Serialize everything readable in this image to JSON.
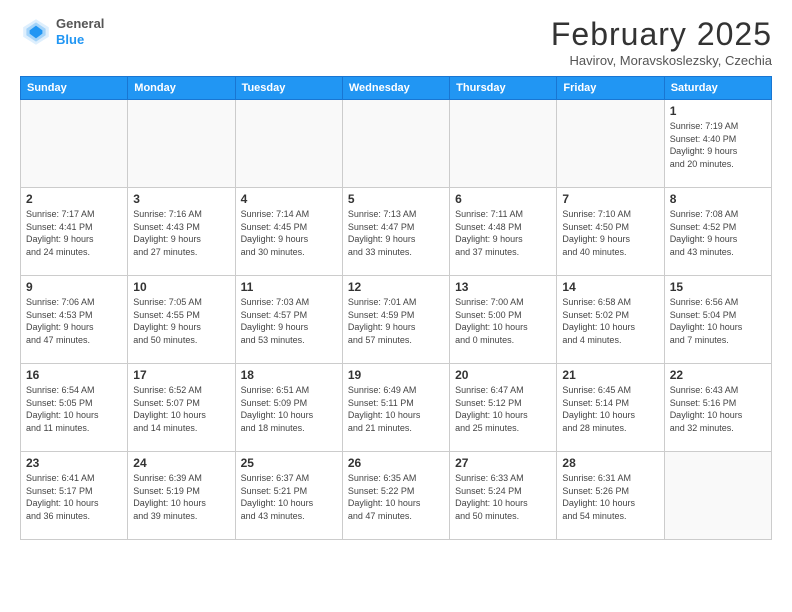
{
  "header": {
    "logo_general": "General",
    "logo_blue": "Blue",
    "month_title": "February 2025",
    "subtitle": "Havirov, Moravskoslezsky, Czechia"
  },
  "weekdays": [
    "Sunday",
    "Monday",
    "Tuesday",
    "Wednesday",
    "Thursday",
    "Friday",
    "Saturday"
  ],
  "weeks": [
    [
      {
        "day": "",
        "info": ""
      },
      {
        "day": "",
        "info": ""
      },
      {
        "day": "",
        "info": ""
      },
      {
        "day": "",
        "info": ""
      },
      {
        "day": "",
        "info": ""
      },
      {
        "day": "",
        "info": ""
      },
      {
        "day": "1",
        "info": "Sunrise: 7:19 AM\nSunset: 4:40 PM\nDaylight: 9 hours\nand 20 minutes."
      }
    ],
    [
      {
        "day": "2",
        "info": "Sunrise: 7:17 AM\nSunset: 4:41 PM\nDaylight: 9 hours\nand 24 minutes."
      },
      {
        "day": "3",
        "info": "Sunrise: 7:16 AM\nSunset: 4:43 PM\nDaylight: 9 hours\nand 27 minutes."
      },
      {
        "day": "4",
        "info": "Sunrise: 7:14 AM\nSunset: 4:45 PM\nDaylight: 9 hours\nand 30 minutes."
      },
      {
        "day": "5",
        "info": "Sunrise: 7:13 AM\nSunset: 4:47 PM\nDaylight: 9 hours\nand 33 minutes."
      },
      {
        "day": "6",
        "info": "Sunrise: 7:11 AM\nSunset: 4:48 PM\nDaylight: 9 hours\nand 37 minutes."
      },
      {
        "day": "7",
        "info": "Sunrise: 7:10 AM\nSunset: 4:50 PM\nDaylight: 9 hours\nand 40 minutes."
      },
      {
        "day": "8",
        "info": "Sunrise: 7:08 AM\nSunset: 4:52 PM\nDaylight: 9 hours\nand 43 minutes."
      }
    ],
    [
      {
        "day": "9",
        "info": "Sunrise: 7:06 AM\nSunset: 4:53 PM\nDaylight: 9 hours\nand 47 minutes."
      },
      {
        "day": "10",
        "info": "Sunrise: 7:05 AM\nSunset: 4:55 PM\nDaylight: 9 hours\nand 50 minutes."
      },
      {
        "day": "11",
        "info": "Sunrise: 7:03 AM\nSunset: 4:57 PM\nDaylight: 9 hours\nand 53 minutes."
      },
      {
        "day": "12",
        "info": "Sunrise: 7:01 AM\nSunset: 4:59 PM\nDaylight: 9 hours\nand 57 minutes."
      },
      {
        "day": "13",
        "info": "Sunrise: 7:00 AM\nSunset: 5:00 PM\nDaylight: 10 hours\nand 0 minutes."
      },
      {
        "day": "14",
        "info": "Sunrise: 6:58 AM\nSunset: 5:02 PM\nDaylight: 10 hours\nand 4 minutes."
      },
      {
        "day": "15",
        "info": "Sunrise: 6:56 AM\nSunset: 5:04 PM\nDaylight: 10 hours\nand 7 minutes."
      }
    ],
    [
      {
        "day": "16",
        "info": "Sunrise: 6:54 AM\nSunset: 5:05 PM\nDaylight: 10 hours\nand 11 minutes."
      },
      {
        "day": "17",
        "info": "Sunrise: 6:52 AM\nSunset: 5:07 PM\nDaylight: 10 hours\nand 14 minutes."
      },
      {
        "day": "18",
        "info": "Sunrise: 6:51 AM\nSunset: 5:09 PM\nDaylight: 10 hours\nand 18 minutes."
      },
      {
        "day": "19",
        "info": "Sunrise: 6:49 AM\nSunset: 5:11 PM\nDaylight: 10 hours\nand 21 minutes."
      },
      {
        "day": "20",
        "info": "Sunrise: 6:47 AM\nSunset: 5:12 PM\nDaylight: 10 hours\nand 25 minutes."
      },
      {
        "day": "21",
        "info": "Sunrise: 6:45 AM\nSunset: 5:14 PM\nDaylight: 10 hours\nand 28 minutes."
      },
      {
        "day": "22",
        "info": "Sunrise: 6:43 AM\nSunset: 5:16 PM\nDaylight: 10 hours\nand 32 minutes."
      }
    ],
    [
      {
        "day": "23",
        "info": "Sunrise: 6:41 AM\nSunset: 5:17 PM\nDaylight: 10 hours\nand 36 minutes."
      },
      {
        "day": "24",
        "info": "Sunrise: 6:39 AM\nSunset: 5:19 PM\nDaylight: 10 hours\nand 39 minutes."
      },
      {
        "day": "25",
        "info": "Sunrise: 6:37 AM\nSunset: 5:21 PM\nDaylight: 10 hours\nand 43 minutes."
      },
      {
        "day": "26",
        "info": "Sunrise: 6:35 AM\nSunset: 5:22 PM\nDaylight: 10 hours\nand 47 minutes."
      },
      {
        "day": "27",
        "info": "Sunrise: 6:33 AM\nSunset: 5:24 PM\nDaylight: 10 hours\nand 50 minutes."
      },
      {
        "day": "28",
        "info": "Sunrise: 6:31 AM\nSunset: 5:26 PM\nDaylight: 10 hours\nand 54 minutes."
      },
      {
        "day": "",
        "info": ""
      }
    ]
  ]
}
